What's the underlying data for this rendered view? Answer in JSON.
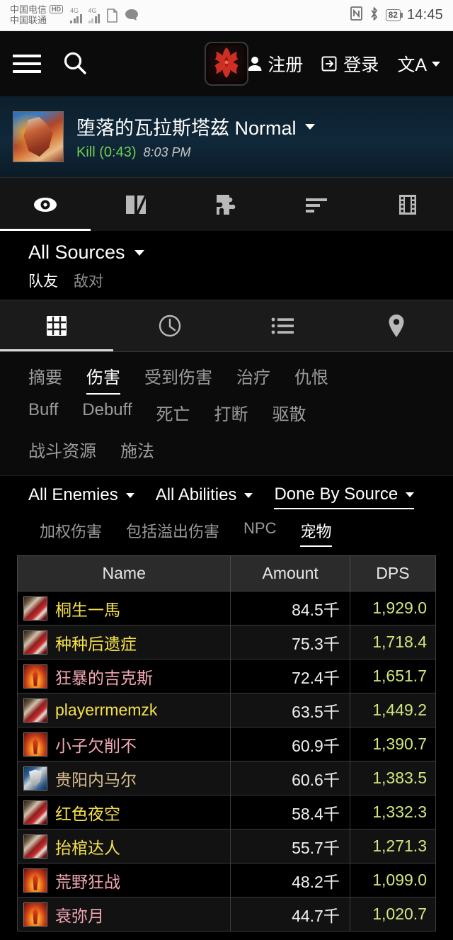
{
  "statusbar": {
    "carrier1": "中国电信",
    "carrier1_badge": "HD",
    "carrier2": "中国联通",
    "net1": "4G",
    "net2": "4G",
    "battery": "82",
    "time": "14:45",
    "icons": [
      "sim-card-icon",
      "message-bubble-icon",
      "nfc-icon",
      "bluetooth-icon",
      "battery-icon"
    ]
  },
  "appbar": {
    "menu_icon": "hamburger-menu-icon",
    "search_icon": "search-icon",
    "logo": "horde-crest-logo",
    "register_label": "注册",
    "login_label": "登录",
    "language_label": "文A"
  },
  "encounter": {
    "icon": "boss-portrait-icon",
    "title": "堕落的瓦拉斯塔兹 Normal",
    "result": "Kill (0:43)",
    "time": "8:03 PM",
    "result_color": "#6ecf55"
  },
  "icon_tabs": [
    {
      "name": "eye-icon",
      "label": "概览",
      "active": true
    },
    {
      "name": "compare-icon",
      "label": "对比",
      "active": false
    },
    {
      "name": "puzzle-icon",
      "label": "插件",
      "active": false
    },
    {
      "name": "bars-icon",
      "label": "排名",
      "active": false
    },
    {
      "name": "film-icon",
      "label": "回放",
      "active": false
    }
  ],
  "sources": {
    "title": "All Sources",
    "sub": [
      {
        "label": "队友",
        "active": true
      },
      {
        "label": "敌对",
        "active": false
      }
    ]
  },
  "icon_tabs2": [
    {
      "name": "grid-icon",
      "label": "表格",
      "active": true
    },
    {
      "name": "clock-icon",
      "label": "时间线",
      "active": false
    },
    {
      "name": "list-icon",
      "label": "列表",
      "active": false
    },
    {
      "name": "map-pin-icon",
      "label": "地图",
      "active": false
    }
  ],
  "text_tabs": [
    {
      "label": "摘要",
      "active": false
    },
    {
      "label": "伤害",
      "active": true
    },
    {
      "label": "受到伤害",
      "active": false
    },
    {
      "label": "治疗",
      "active": false
    },
    {
      "label": "仇恨",
      "active": false
    },
    {
      "label": "Buff",
      "active": false
    },
    {
      "label": "Debuff",
      "active": false
    },
    {
      "label": "死亡",
      "active": false
    },
    {
      "label": "打断",
      "active": false
    },
    {
      "label": "驱散",
      "active": false
    },
    {
      "label": "战斗资源",
      "active": false
    },
    {
      "label": "施法",
      "active": false
    }
  ],
  "filters": {
    "dropdowns": [
      {
        "label": "All Enemies",
        "underlined": false
      },
      {
        "label": "All Abilities",
        "underlined": false
      },
      {
        "label": "Done By Source",
        "underlined": true
      }
    ],
    "subfilters": [
      {
        "label": "加权伤害",
        "active": false
      },
      {
        "label": "包括溢出伤害",
        "active": false
      },
      {
        "label": "NPC",
        "active": false
      },
      {
        "label": "宠物",
        "active": true
      }
    ]
  },
  "table": {
    "headers": [
      "Name",
      "Amount",
      "DPS"
    ],
    "rows": [
      {
        "name": "桐生一馬",
        "amount": "84.5千",
        "dps": "1,929.0",
        "spec": "spec-rogue",
        "color": "#f5e14b"
      },
      {
        "name": "种种后遗症",
        "amount": "75.3千",
        "dps": "1,718.4",
        "spec": "spec-rogue",
        "color": "#f5e14b"
      },
      {
        "name": "狂暴的吉克斯",
        "amount": "72.4千",
        "dps": "1,651.7",
        "spec": "spec-paladin",
        "color": "#f3a7b4"
      },
      {
        "name": "playerrmemzk",
        "amount": "63.5千",
        "dps": "1,449.2",
        "spec": "spec-rogue",
        "color": "#f5e14b"
      },
      {
        "name": "小子欠削不",
        "amount": "60.9千",
        "dps": "1,390.7",
        "spec": "spec-paladin",
        "color": "#f3a7b4"
      },
      {
        "name": "贵阳内马尔",
        "amount": "60.6千",
        "dps": "1,383.5",
        "spec": "spec-warrior",
        "color": "#d7bd8f"
      },
      {
        "name": "红色夜空",
        "amount": "58.4千",
        "dps": "1,332.3",
        "spec": "spec-rogue",
        "color": "#f5e14b"
      },
      {
        "name": "抬棺达人",
        "amount": "55.7千",
        "dps": "1,271.3",
        "spec": "spec-rogue",
        "color": "#f5e14b"
      },
      {
        "name": "荒野狂战",
        "amount": "48.2千",
        "dps": "1,099.0",
        "spec": "spec-paladin",
        "color": "#f3a7b4"
      },
      {
        "name": "衰弥月",
        "amount": "44.7千",
        "dps": "1,020.7",
        "spec": "spec-paladin",
        "color": "#f3a7b4"
      }
    ]
  }
}
